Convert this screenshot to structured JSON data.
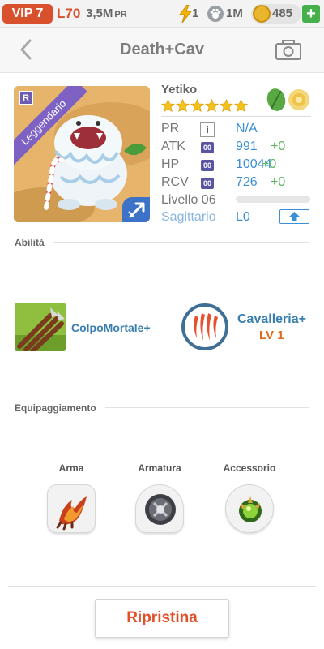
{
  "status_bar": {
    "vip": "VIP 7",
    "player_level": "L70",
    "power": "3,5M",
    "power_unit": "PR",
    "energy": "1",
    "paws": "1M",
    "coins": "485",
    "add_label": "+"
  },
  "header": {
    "title": "Death+Cav"
  },
  "hero": {
    "badge": "R",
    "rarity": "Leggendario",
    "name": "Yetiko",
    "stars": 6,
    "elements": [
      "leaf-icon",
      "sun-icon"
    ],
    "stats": [
      {
        "label": "PR",
        "tag": "i",
        "value": "N/A",
        "bonus": ""
      },
      {
        "label": "ATK",
        "tag": "00",
        "value": "991",
        "bonus": "+0"
      },
      {
        "label": "HP",
        "tag": "00",
        "value": "10044",
        "bonus": "+0"
      },
      {
        "label": "RCV",
        "tag": "00",
        "value": "726",
        "bonus": "+0"
      }
    ],
    "level": "Livello 06",
    "xp_progress": 0.0,
    "hero_class": "Sagittario",
    "class_level": "L0"
  },
  "abilities": {
    "title": "Abilità",
    "skill_name": "ColpoMortale+",
    "passive_name": "Cavalleria+",
    "passive_level": "LV 1"
  },
  "equipment": {
    "title": "Equipaggiamento",
    "slots": [
      {
        "label": "Arma",
        "icon": "fire-claw-icon"
      },
      {
        "label": "Armatura",
        "icon": "armor-shield-icon"
      },
      {
        "label": "Accessorio",
        "icon": "green-orb-icon"
      }
    ]
  },
  "reset_label": "Ripristina",
  "colors": {
    "accent_orange": "#d9502c",
    "link_blue": "#3a8fd6",
    "bonus_green": "#5cb85c",
    "rarity_purple": "#7d62c3"
  }
}
